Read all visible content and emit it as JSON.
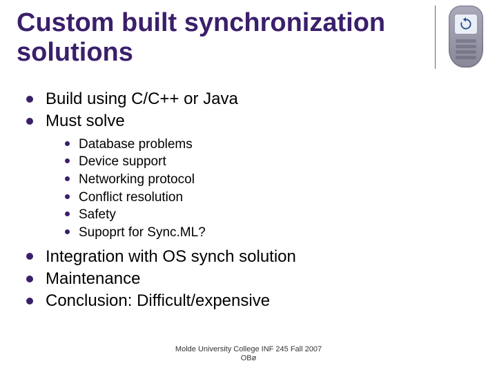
{
  "title": "Custom built synchronization solutions",
  "bullets": {
    "b0": "Build using C/C++ or Java",
    "b1": "Must solve",
    "sub": {
      "s0": "Database problems",
      "s1": "Device support",
      "s2": "Networking protocol",
      "s3": "Conflict resolution",
      "s4": "Safety",
      "s5": "Supoprt for Sync.ML?"
    },
    "b2": "Integration with OS synch solution",
    "b3": "Maintenance",
    "b4": "Conclusion: Difficult/expensive"
  },
  "footer": {
    "line1": "Molde University College INF 245 Fall 2007",
    "line2": "OBø"
  },
  "icon": "mobile-phone"
}
